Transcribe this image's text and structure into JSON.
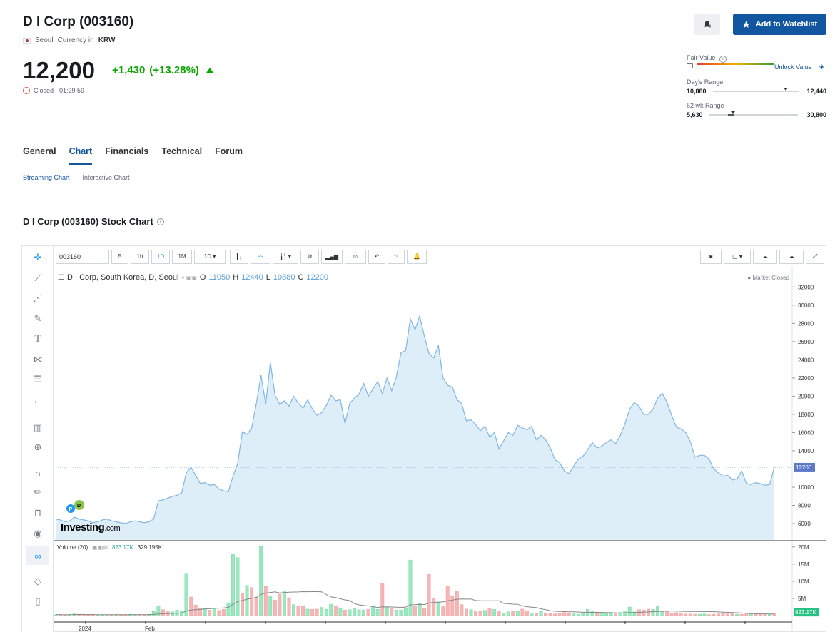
{
  "header": {
    "title": "D I Corp (003160)",
    "exchange": "Seoul",
    "currency_label": "Currency in",
    "currency": "KRW",
    "price": "12,200",
    "change_abs": "+1,430",
    "change_pct": "(+13.28%)",
    "status": "Closed · 01:29:59",
    "watchlist_label": "Add to Watchlist"
  },
  "ranges": {
    "fair_value_label": "Fair Value",
    "unlock_label": "Unlock Value",
    "day_label": "Day's Range",
    "day_low": "10,880",
    "day_high": "12,440",
    "wk_label": "52 wk Range",
    "wk_low": "5,630",
    "wk_high": "30,800"
  },
  "tabs": [
    "General",
    "Chart",
    "Financials",
    "Technical",
    "Forum"
  ],
  "subtabs": [
    "Streaming Chart",
    "Interactive Chart"
  ],
  "chart_section_title": "D I Corp (003160) Stock Chart",
  "toolbar": {
    "symbol": "003160",
    "intervals": [
      "5",
      "1h",
      "1D",
      "1M",
      "1D"
    ]
  },
  "legend": {
    "name": "D I Corp, South Korea, D, Seoul",
    "o_label": "O",
    "o": "11050",
    "h_label": "H",
    "h": "12440",
    "l_label": "L",
    "l": "10880",
    "c_label": "C",
    "c": "12200",
    "market_status": "Market Closed",
    "volume_label": "Volume (20)",
    "vol_value": "823.17K",
    "vol_ma": "329.195K",
    "watermark": "Investing",
    "watermark_suffix": ".com",
    "x_labels": [
      "2024",
      "Feb"
    ]
  },
  "chart_data": {
    "type": "area",
    "y_ticks": [
      32000,
      30000,
      28000,
      26000,
      24000,
      22000,
      20000,
      18000,
      16000,
      14000,
      12000,
      10000,
      8000,
      6000
    ],
    "ylim": [
      4200,
      33200
    ],
    "last_price": 12200,
    "close": [
      6500,
      6400,
      6200,
      6300,
      6700,
      6500,
      6400,
      6300,
      6100,
      6200,
      6400,
      6500,
      6300,
      6200,
      6100,
      6000,
      6200,
      6300,
      6200,
      6100,
      6200,
      6500,
      8500,
      8600,
      8800,
      9000,
      9100,
      9400,
      11600,
      12200,
      11300,
      10400,
      10500,
      10200,
      10300,
      9800,
      9600,
      9500,
      11200,
      12600,
      16100,
      15800,
      16500,
      19200,
      22300,
      19100,
      23700,
      20100,
      19100,
      19500,
      18900,
      20000,
      19200,
      18700,
      19600,
      18600,
      17900,
      18200,
      19000,
      20100,
      19500,
      19600,
      17000,
      19200,
      19800,
      20200,
      21400,
      20000,
      20800,
      21600,
      20300,
      22000,
      20600,
      22100,
      24800,
      25000,
      28500,
      27300,
      28800,
      26600,
      24700,
      24200,
      25600,
      22000,
      21200,
      21000,
      19600,
      19200,
      17300,
      17400,
      16900,
      16200,
      16700,
      15500,
      16000,
      14200,
      15100,
      16000,
      15700,
      16800,
      16500,
      16300,
      16700,
      15200,
      15700,
      15200,
      14300,
      13000,
      12700,
      11800,
      11500,
      12300,
      13100,
      13400,
      14100,
      14900,
      14300,
      14500,
      14900,
      15200,
      14800,
      15700,
      17000,
      18600,
      19300,
      18900,
      18000,
      18000,
      18600,
      19800,
      20300,
      19300,
      17900,
      16600,
      16400,
      16000,
      15000,
      13300,
      13500,
      13500,
      13100,
      12000,
      11600,
      11200,
      11300,
      10800,
      10900,
      11800,
      10400,
      10300,
      10500,
      10400,
      10200,
      10300,
      12200
    ],
    "volume_m": [
      0.3,
      0.2,
      0.2,
      0.3,
      0.5,
      0.4,
      0.3,
      0.2,
      0.2,
      0.2,
      0.2,
      0.3,
      0.2,
      0.3,
      0.2,
      0.3,
      0.4,
      0.3,
      0.3,
      0.2,
      0.4,
      1.2,
      2.9,
      1.7,
      1.4,
      1.1,
      1.6,
      1.2,
      12.3,
      5.4,
      3.1,
      2.2,
      2.1,
      1.6,
      2.2,
      1.5,
      1.8,
      3.5,
      17.8,
      16.9,
      6.6,
      8.8,
      8.2,
      5.4,
      20.1,
      8.5,
      5.7,
      4.5,
      6.3,
      7.2,
      5.2,
      3.2,
      2.8,
      2.9,
      1.9,
      1.8,
      1.9,
      2.4,
      1.8,
      3.3,
      2.7,
      2.1,
      1.6,
      1.7,
      2.1,
      1.7,
      1.6,
      1.8,
      2.7,
      1.8,
      9.4,
      2.5,
      2.1,
      1.6,
      1.6,
      2.1,
      16.2,
      2.8,
      3.7,
      2.1,
      12.2,
      5.1,
      3.8,
      2.6,
      8.6,
      5.6,
      7.1,
      3.2,
      1.9,
      1.7,
      1.4,
      1.2,
      1.5,
      2.1,
      1.8,
      1.4,
      0.8,
      1.1,
      1.2,
      1.2,
      1.9,
      1.4,
      0.8,
      0.7,
      1.2,
      0.6,
      0.6,
      0.5,
      0.7,
      0.9,
      0.6,
      0.5,
      0.4,
      0.7,
      1.8,
      1.3,
      0.7,
      0.7,
      0.6,
      0.6,
      0.7,
      0.9,
      1.4,
      2.5,
      1.1,
      1.7,
      1.6,
      1.9,
      1.8,
      2.8,
      1.1,
      1.3,
      0.6,
      0.9,
      0.6,
      0.5,
      0.5,
      0.4,
      0.4,
      0.5,
      0.3,
      0.4,
      0.5,
      0.6,
      0.5,
      0.6,
      0.4,
      0.4,
      0.5,
      0.6,
      0.4,
      0.5,
      0.5,
      0.4,
      0.8
    ],
    "vol_up": [
      1,
      0,
      0,
      1,
      1,
      0,
      0,
      0,
      0,
      1,
      1,
      1,
      0,
      1,
      0,
      0,
      1,
      1,
      0,
      0,
      1,
      1,
      1,
      0,
      0,
      1,
      1,
      1,
      1,
      0,
      0,
      0,
      1,
      0,
      1,
      0,
      0,
      1,
      1,
      1,
      0,
      1,
      0,
      0,
      1,
      0,
      1,
      0,
      0,
      1,
      0,
      1,
      0,
      0,
      1,
      0,
      0,
      1,
      1,
      1,
      0,
      1,
      0,
      1,
      1,
      1,
      1,
      0,
      1,
      1,
      0,
      1,
      0,
      1,
      1,
      1,
      1,
      0,
      1,
      0,
      0,
      0,
      1,
      0,
      0,
      0,
      0,
      0,
      0,
      1,
      0,
      0,
      1,
      0,
      1,
      0,
      1,
      1,
      0,
      1,
      0,
      0,
      1,
      0,
      1,
      0,
      0,
      0,
      0,
      0,
      0,
      1,
      1,
      1,
      1,
      1,
      0,
      1,
      1,
      1,
      0,
      1,
      1,
      1,
      1,
      0,
      0,
      0,
      1,
      1,
      1,
      0,
      0,
      0,
      0,
      0,
      0,
      0,
      1,
      1,
      0,
      0,
      0,
      0,
      0,
      0,
      1,
      0,
      0,
      1,
      0,
      0,
      0,
      1
    ],
    "volume_ticks": [
      "20M",
      "15M",
      "10M",
      "5M"
    ],
    "volume_last_label": "823.17K"
  }
}
